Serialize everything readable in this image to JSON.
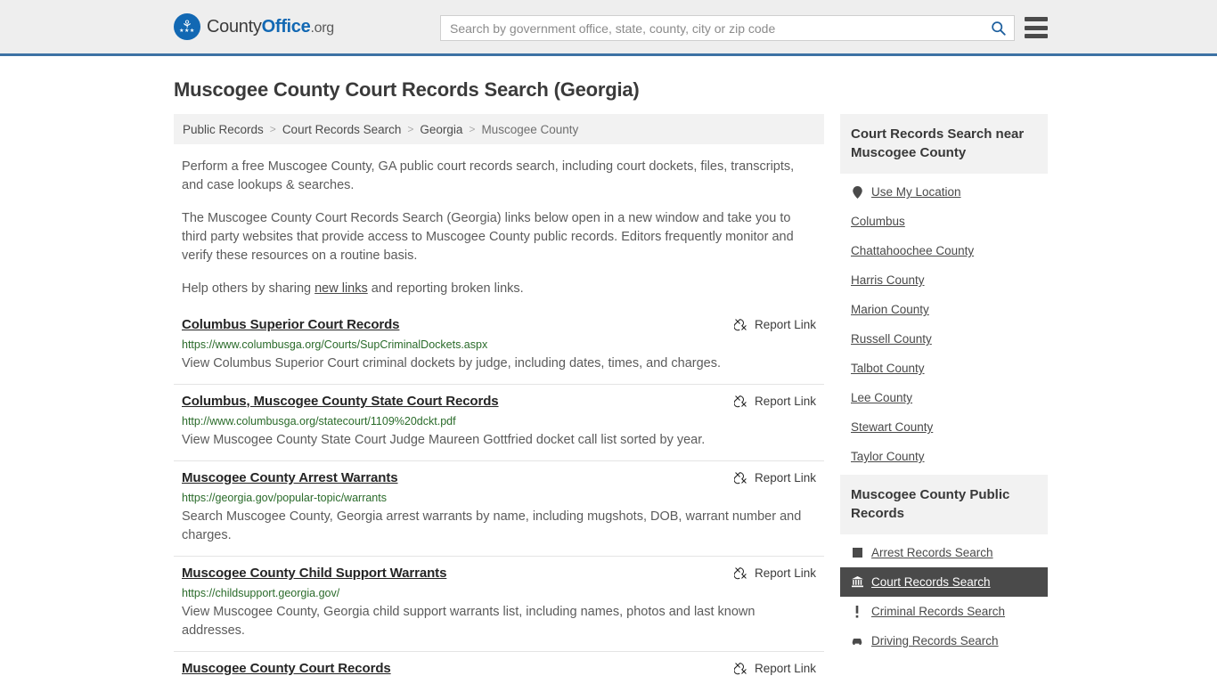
{
  "header": {
    "logo": {
      "text_part1": "County",
      "text_part2": "Office",
      "text_part3": ".org",
      "icon": "eagle-seal-icon"
    },
    "search": {
      "placeholder": "Search by government office, state, county, city or zip code",
      "value": "",
      "search_icon": "search-icon"
    },
    "menu_icon": "hamburger-menu-icon",
    "accent_color": "#3d72a4"
  },
  "page_title": "Muscogee County Court Records Search (Georgia)",
  "breadcrumb": [
    {
      "label": "Public Records",
      "current": false
    },
    {
      "label": "Court Records Search",
      "current": false
    },
    {
      "label": "Georgia",
      "current": false
    },
    {
      "label": "Muscogee County",
      "current": true
    }
  ],
  "breadcrumb_separator": ">",
  "intro": {
    "p1": "Perform a free Muscogee County, GA public court records search, including court dockets, files, transcripts, and case lookups & searches.",
    "p2": "The Muscogee County Court Records Search (Georgia) links below open in a new window and take you to third party websites that provide access to Muscogee County public records. Editors frequently monitor and verify these resources on a routine basis.",
    "p3_before": "Help others by sharing ",
    "p3_link": "new links",
    "p3_after": " and reporting broken links."
  },
  "report_link_label": "Report Link",
  "report_link_icon": "broken-link-icon",
  "results": [
    {
      "title": "Columbus Superior Court Records",
      "url": "https://www.columbusga.org/Courts/SupCriminalDockets.aspx",
      "description": "View Columbus Superior Court criminal dockets by judge, including dates, times, and charges."
    },
    {
      "title": "Columbus, Muscogee County State Court Records",
      "url": "http://www.columbusga.org/statecourt/1109%20dckt.pdf",
      "description": "View Muscogee County State Court Judge Maureen Gottfried docket call list sorted by year."
    },
    {
      "title": "Muscogee County Arrest Warrants",
      "url": "https://georgia.gov/popular-topic/warrants",
      "description": "Search Muscogee County, Georgia arrest warrants by name, including mugshots, DOB, warrant number and charges."
    },
    {
      "title": "Muscogee County Child Support Warrants",
      "url": "https://childsupport.georgia.gov/",
      "description": "View Muscogee County, Georgia child support warrants list, including names, photos and last known addresses."
    },
    {
      "title": "Muscogee County Court Records",
      "url": "",
      "description": ""
    }
  ],
  "sidebar": {
    "nearby_card": {
      "title": "Court Records Search near Muscogee County",
      "items": [
        {
          "label": "Use My Location",
          "icon": "map-pin-icon"
        },
        {
          "label": "Columbus",
          "icon": ""
        },
        {
          "label": "Chattahoochee County",
          "icon": ""
        },
        {
          "label": "Harris County",
          "icon": ""
        },
        {
          "label": "Marion County",
          "icon": ""
        },
        {
          "label": "Russell County",
          "icon": ""
        },
        {
          "label": "Talbot County",
          "icon": ""
        },
        {
          "label": "Lee County",
          "icon": ""
        },
        {
          "label": "Stewart County",
          "icon": ""
        },
        {
          "label": "Taylor County",
          "icon": ""
        }
      ]
    },
    "public_records_card": {
      "title": "Muscogee County Public Records",
      "items": [
        {
          "label": "Arrest Records Search",
          "icon": "square-icon",
          "active": false
        },
        {
          "label": "Court Records Search",
          "icon": "courthouse-icon",
          "active": true
        },
        {
          "label": "Criminal Records Search",
          "icon": "exclamation-icon",
          "active": false
        },
        {
          "label": "Driving Records Search",
          "icon": "car-icon",
          "active": false
        }
      ]
    }
  }
}
